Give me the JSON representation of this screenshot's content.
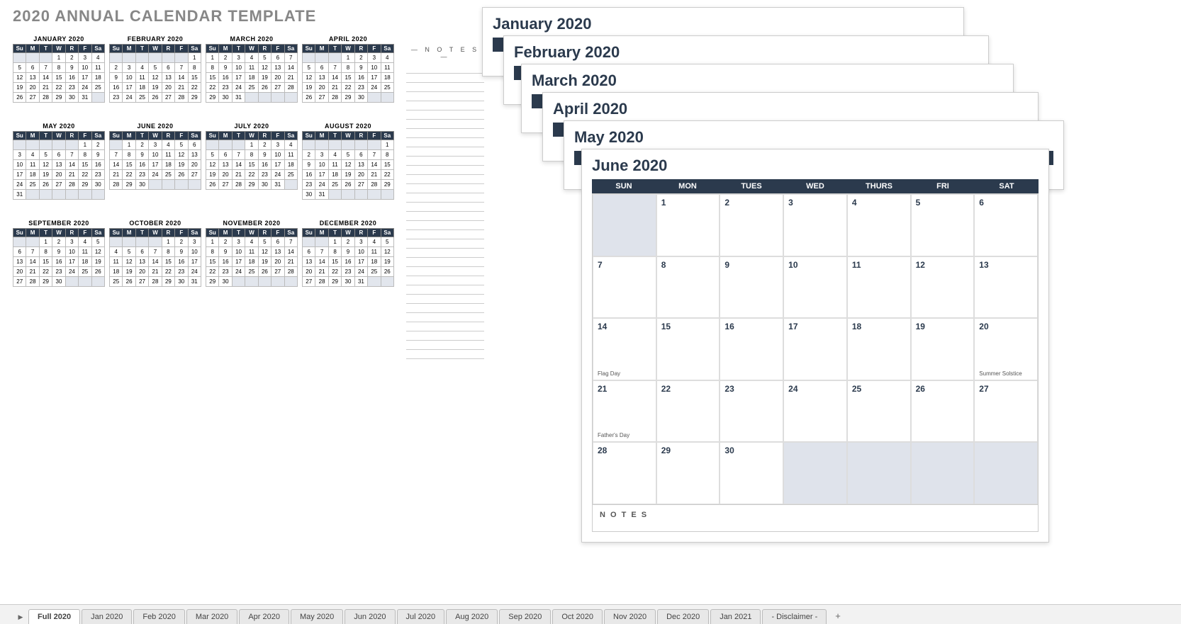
{
  "title": "2020 ANNUAL CALENDAR TEMPLATE",
  "notes_label": "— N O T E S —",
  "mini_day_headers": [
    "Su",
    "M",
    "T",
    "W",
    "R",
    "F",
    "Sa"
  ],
  "months": [
    {
      "name": "JANUARY 2020",
      "first": 3,
      "days": 31
    },
    {
      "name": "FEBRUARY 2020",
      "first": 6,
      "days": 29
    },
    {
      "name": "MARCH 2020",
      "first": 0,
      "days": 31
    },
    {
      "name": "APRIL 2020",
      "first": 3,
      "days": 30
    },
    {
      "name": "MAY 2020",
      "first": 5,
      "days": 31
    },
    {
      "name": "JUNE 2020",
      "first": 1,
      "days": 30
    },
    {
      "name": "JULY 2020",
      "first": 3,
      "days": 31
    },
    {
      "name": "AUGUST 2020",
      "first": 6,
      "days": 31
    },
    {
      "name": "SEPTEMBER 2020",
      "first": 2,
      "days": 30
    },
    {
      "name": "OCTOBER 2020",
      "first": 4,
      "days": 31
    },
    {
      "name": "NOVEMBER 2020",
      "first": 0,
      "days": 30
    },
    {
      "name": "DECEMBER 2020",
      "first": 2,
      "days": 31
    }
  ],
  "big_day_headers": [
    "SUN",
    "MON",
    "TUES",
    "WED",
    "THURS",
    "FRI",
    "SAT"
  ],
  "stack_pages": [
    {
      "title": "January 2020"
    },
    {
      "title": "February 2020"
    },
    {
      "title": "March 2020"
    },
    {
      "title": "April 2020"
    },
    {
      "title": "May 2020"
    }
  ],
  "june": {
    "title": "June 2020",
    "first": 1,
    "days": 30,
    "events": {
      "14": "Flag Day",
      "20": "Summer Solstice",
      "21": "Father's Day"
    },
    "notes_label": "N O T E S"
  },
  "tabs": [
    "Full 2020",
    "Jan 2020",
    "Feb 2020",
    "Mar 2020",
    "Apr 2020",
    "May 2020",
    "Jun 2020",
    "Jul 2020",
    "Aug 2020",
    "Sep 2020",
    "Oct 2020",
    "Nov 2020",
    "Dec 2020",
    "Jan 2021",
    "- Disclaimer -"
  ],
  "active_tab": 0
}
